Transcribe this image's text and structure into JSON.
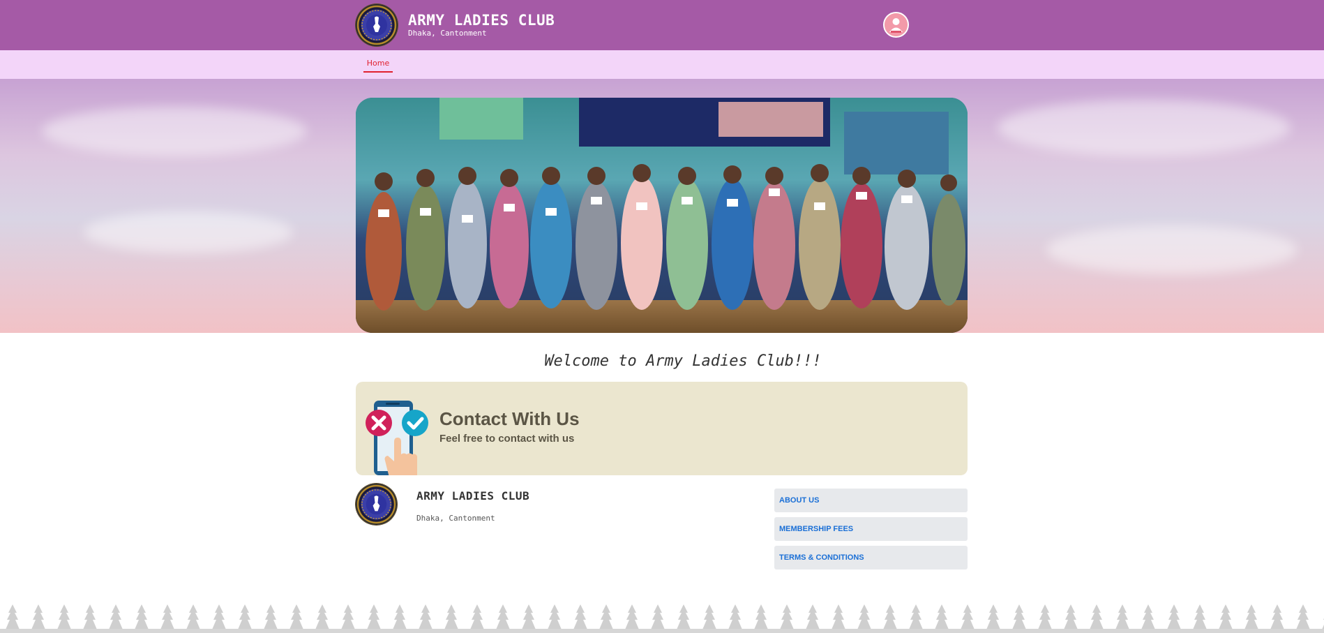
{
  "header": {
    "title": "ARMY LADIES CLUB",
    "subtitle": "Dhaka, Cantonment",
    "logo_icon": "club-emblem-icon",
    "avatar_icon": "user-avatar-icon"
  },
  "nav": {
    "items": [
      {
        "label": "Home",
        "active": true
      }
    ]
  },
  "hero": {
    "image": "group-photo"
  },
  "welcome": {
    "text": "Welcome to Army Ladies Club!!!"
  },
  "contact": {
    "title": "Contact With Us",
    "subtitle": "Feel free to contact with us",
    "icon": "phone-contact-icon"
  },
  "footer": {
    "title": "ARMY LADIES CLUB",
    "subtitle": "Dhaka, Cantonment",
    "links": [
      {
        "label": "ABOUT US"
      },
      {
        "label": "MEMBERSHIP FEES"
      },
      {
        "label": "TERMS & CONDITIONS"
      }
    ]
  },
  "colors": {
    "header_bg": "#a55aa6",
    "nav_bg": "#f3d5f9",
    "active_nav": "#e0212e",
    "contact_bg": "#ebe6cf",
    "link_color": "#1a6fd6"
  }
}
